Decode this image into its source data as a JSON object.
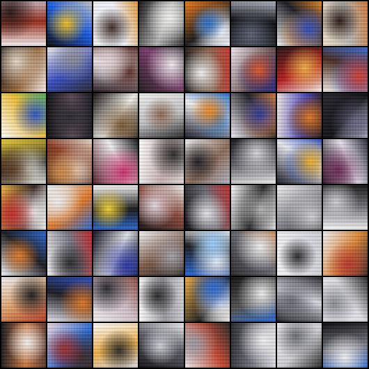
{
  "grid": {
    "rows": 8,
    "cols": 8,
    "tiles": [
      {
        "palette": [
          "#f7f1f2",
          "#c8b2b7",
          "#2a1818",
          "#9b2d1b"
        ],
        "style": "light"
      },
      {
        "palette": [
          "#0f0f12",
          "#f2c022",
          "#1c5ee6",
          "#c6c7c7"
        ],
        "style": "dark"
      },
      {
        "palette": [
          "#f0f1ef",
          "#e29b3c",
          "#3f2a24",
          "#f2f6ff"
        ],
        "style": "light"
      },
      {
        "palette": [
          "#1a1a1d",
          "#f1f1ef",
          "#b6b6b6",
          "#3a3a3a"
        ],
        "style": "dark"
      },
      {
        "palette": [
          "#f07e1f",
          "#2b71c7",
          "#f6f8ff",
          "#1a1a1a"
        ],
        "style": "mixed"
      },
      {
        "palette": [
          "#2c2f38",
          "#5d6475",
          "#0f0f14",
          "#b2b8c4"
        ],
        "style": "dark"
      },
      {
        "palette": [
          "#f1f2f4",
          "#2a4fbf",
          "#e38b2b",
          "#1d1d24"
        ],
        "style": "mixed"
      },
      {
        "palette": [
          "#f0e0cc",
          "#d47b3a",
          "#2b1a16",
          "#b9b7b1"
        ],
        "style": "light"
      },
      {
        "palette": [
          "#1a1515",
          "#e7d8c6",
          "#9b6a41",
          "#f7f0ea"
        ],
        "style": "dark"
      },
      {
        "palette": [
          "#ededed",
          "#2b2b30",
          "#8c8c96",
          "#3a4fc1"
        ],
        "style": "light"
      },
      {
        "palette": [
          "#2a1b22",
          "#e3d2d6",
          "#5b2f2a",
          "#f1eef1"
        ],
        "style": "mixed"
      },
      {
        "palette": [
          "#241c21",
          "#f2eef0",
          "#7b3f6c",
          "#121214"
        ],
        "style": "dark"
      },
      {
        "palette": [
          "#151515",
          "#f4f4f4",
          "#8c6a54",
          "#c83a2d"
        ],
        "style": "dark"
      },
      {
        "palette": [
          "#f3e9f1",
          "#e15b2a",
          "#2a2b7c",
          "#6f5555"
        ],
        "style": "mixed"
      },
      {
        "palette": [
          "#2a1515",
          "#f0b14a",
          "#b71f1f",
          "#f5f2ee"
        ],
        "style": "dark"
      },
      {
        "palette": [
          "#f7f0ec",
          "#d33f2f",
          "#3f6fd8",
          "#4b2d20"
        ],
        "style": "mixed"
      },
      {
        "palette": [
          "#ffffff",
          "#5bbf54",
          "#2e57c8",
          "#f0c03e"
        ],
        "style": "light"
      },
      {
        "palette": [
          "#121216",
          "#2a2a33",
          "#5b4a55",
          "#1d1d24"
        ],
        "style": "dark"
      },
      {
        "palette": [
          "#1a1514",
          "#7a5b37",
          "#f3efe9",
          "#2e2520"
        ],
        "style": "dark"
      },
      {
        "palette": [
          "#f2f2f3",
          "#2a2a2c",
          "#8e6a55",
          "#c2c2c4"
        ],
        "style": "light"
      },
      {
        "palette": [
          "#1b1d2c",
          "#f28a1e",
          "#2a72c8",
          "#f3f2f2"
        ],
        "style": "mixed"
      },
      {
        "palette": [
          "#f3eef8",
          "#2c3c9b",
          "#d27b43",
          "#222228"
        ],
        "style": "mixed"
      },
      {
        "palette": [
          "#f0e6e2",
          "#e07a2b",
          "#2b1b19",
          "#4d4cc6"
        ],
        "style": "mixed"
      },
      {
        "palette": [
          "#2a2631",
          "#6b6a87",
          "#121216",
          "#d8d8e6"
        ],
        "style": "dark"
      },
      {
        "palette": [
          "#f2d23a",
          "#5b3b22",
          "#e0e0d6",
          "#2b2b2b"
        ],
        "style": "mixed"
      },
      {
        "palette": [
          "#2a1b17",
          "#d08b4b",
          "#eaded4",
          "#8a3b22"
        ],
        "style": "mixed"
      },
      {
        "palette": [
          "#5a1f2f",
          "#c92e6b",
          "#f1f1f1",
          "#1a1a1f"
        ],
        "style": "dark"
      },
      {
        "palette": [
          "#ffffff",
          "#e1d6d6",
          "#2b2b2b",
          "#c6b1b1"
        ],
        "style": "light"
      },
      {
        "palette": [
          "#f3f3f6",
          "#b4b4c6",
          "#1f1f24",
          "#8d6d5a"
        ],
        "style": "light"
      },
      {
        "palette": [
          "#1c1b20",
          "#d7d7db",
          "#6a6a72",
          "#f1f1f1"
        ],
        "style": "dark"
      },
      {
        "palette": [
          "#1b1d2a",
          "#f1b22a",
          "#2e55c6",
          "#e9e9ef"
        ],
        "style": "mixed"
      },
      {
        "palette": [
          "#1a1216",
          "#6c2a57",
          "#e8e2ef",
          "#2b2b3a"
        ],
        "style": "dark"
      },
      {
        "palette": [
          "#f0b14a",
          "#c42e2e",
          "#f2f2f2",
          "#3a2a25"
        ],
        "style": "mixed"
      },
      {
        "palette": [
          "#e9f6ff",
          "#2c6bd6",
          "#f0f0f0",
          "#e07a2b"
        ],
        "style": "light"
      },
      {
        "palette": [
          "#ffffff",
          "#2c6bd6",
          "#f2d23a",
          "#1a1a1a"
        ],
        "style": "light"
      },
      {
        "palette": [
          "#1a1517",
          "#e6dbe3",
          "#8c4c3f",
          "#f4f4f4"
        ],
        "style": "dark"
      },
      {
        "palette": [
          "#0e0e12",
          "#e6e6ea",
          "#6b6b74",
          "#c3302e"
        ],
        "style": "dark"
      },
      {
        "palette": [
          "#ffffff",
          "#e6e6e6",
          "#b5b5b5",
          "#2b2b2b"
        ],
        "style": "light"
      },
      {
        "palette": [
          "#f2f2f3",
          "#2b2b2b",
          "#d1d1d6",
          "#8a8a92"
        ],
        "style": "light"
      },
      {
        "palette": [
          "#ffffff",
          "#1a1a1a",
          "#cfcfd4",
          "#6f6f77"
        ],
        "style": "light"
      },
      {
        "palette": [
          "#f7f7fb",
          "#2d6bd5",
          "#e17b2b",
          "#1e1e22"
        ],
        "style": "light"
      },
      {
        "palette": [
          "#f1f1f3",
          "#c1282c",
          "#2c2c2c",
          "#7a7a86"
        ],
        "style": "light"
      },
      {
        "palette": [
          "#151524",
          "#2e3aa7",
          "#e2e2ea",
          "#0f0f12"
        ],
        "style": "dark"
      },
      {
        "palette": [
          "#f6f6f6",
          "#2b2b2b",
          "#a3a3aa",
          "#7d5b4b"
        ],
        "style": "light"
      },
      {
        "palette": [
          "#2a6bd8",
          "#9ad0ff",
          "#f7f7f9",
          "#1c1c1f"
        ],
        "style": "mixed"
      },
      {
        "palette": [
          "#2b2b2f",
          "#f1f1f1",
          "#6d6d76",
          "#c67a3c"
        ],
        "style": "dark"
      },
      {
        "palette": [
          "#f6f6f6",
          "#cfcfd6",
          "#2b2b2b",
          "#e1e1ea"
        ],
        "style": "light"
      },
      {
        "palette": [
          "#f2f2f2",
          "#2b2b2b",
          "#b83b2f",
          "#e08a3c"
        ],
        "style": "light"
      },
      {
        "palette": [
          "#f2f2f3",
          "#b83d25",
          "#1f1f24",
          "#e0a06a"
        ],
        "style": "light"
      },
      {
        "palette": [
          "#e6e6ef",
          "#2c4fbf",
          "#e07a2b",
          "#1c1c22"
        ],
        "style": "light"
      },
      {
        "palette": [
          "#f2eef2",
          "#8a4b40",
          "#2a2a2f",
          "#d2c0ca"
        ],
        "style": "light"
      },
      {
        "palette": [
          "#ffffff",
          "#d3d3d8",
          "#2b2b2b",
          "#9a9aa2"
        ],
        "style": "light"
      },
      {
        "palette": [
          "#f0b14a",
          "#2c6bd6",
          "#f2f2f2",
          "#1c1c1f"
        ],
        "style": "mixed"
      },
      {
        "palette": [
          "#141414",
          "#f1f1f1",
          "#555555",
          "#2c6bd6"
        ],
        "style": "dark"
      },
      {
        "palette": [
          "#1b1b21",
          "#6a6a75",
          "#d8d8e3",
          "#2b2b2f"
        ],
        "style": "dark"
      },
      {
        "palette": [
          "#f5f5f7",
          "#2b2b2b",
          "#8b8b94",
          "#e0e0e6"
        ],
        "style": "light"
      },
      {
        "palette": [
          "#1a1a1f",
          "#f2f2f2",
          "#d27b43",
          "#5a3a34"
        ],
        "style": "dark"
      },
      {
        "palette": [
          "#f0dbe0",
          "#9f2e2e",
          "#3a2b2b",
          "#2c6bd6"
        ],
        "style": "mixed"
      },
      {
        "palette": [
          "#ffffff",
          "#d9d9de",
          "#2b2b2b",
          "#f0b14a"
        ],
        "style": "light"
      },
      {
        "palette": [
          "#151517",
          "#d1d1d8",
          "#5f5f6a",
          "#f0f0f4"
        ],
        "style": "dark"
      },
      {
        "palette": [
          "#f1f1f2",
          "#2b2b2b",
          "#9b9ba6",
          "#c64b34"
        ],
        "style": "light"
      },
      {
        "palette": [
          "#2a2a30",
          "#f3f3f3",
          "#7b7b86",
          "#e0e0e7"
        ],
        "style": "dark"
      },
      {
        "palette": [
          "#ffffff",
          "#2b2b2b",
          "#6d6d77",
          "#cfcfd4"
        ],
        "style": "light"
      },
      {
        "palette": [
          "#0f0f12",
          "#f2f2f2",
          "#7b7b86",
          "#2c6bd6"
        ],
        "style": "dark"
      }
    ]
  }
}
